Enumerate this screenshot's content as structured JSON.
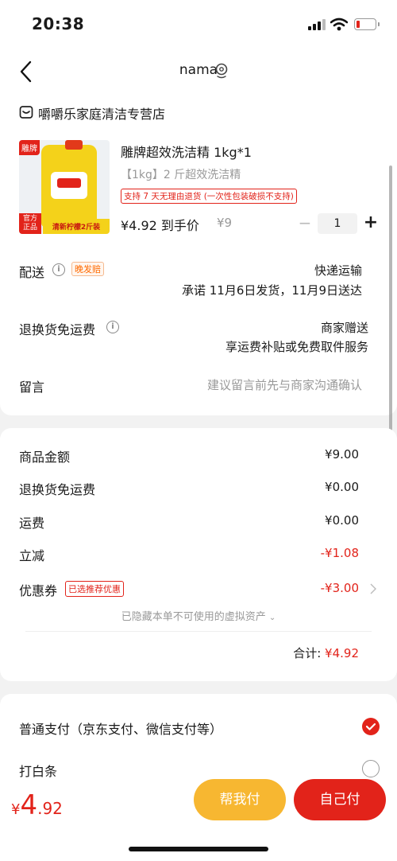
{
  "status_bar": {
    "time": "20:38"
  },
  "header": {
    "title": "nama"
  },
  "store": {
    "name": "嚼嚼乐家庭清洁专营店"
  },
  "product": {
    "title": "雕牌超效洗洁精 1kg*1",
    "spec": "【1kg】2 斤超效洗洁精",
    "return_tag": "支持 7 天无理由退货 (一次性包装破损不支持)",
    "price": "¥4.92 到手价",
    "original_price": "¥9",
    "quantity": "1",
    "image_badges": {
      "brand": "雕牌",
      "official": "官方\n正品",
      "promo": "清新柠檬2斤装"
    }
  },
  "delivery": {
    "label": "配送",
    "tag": "晚发赔",
    "method": "快递运输",
    "promise": "承诺 11月6日发货，11月9日送达"
  },
  "return_shipping": {
    "label": "退换货免运费",
    "value1": "商家赠送",
    "value2": "享运费补贴或免费取件服务"
  },
  "message": {
    "label": "留言",
    "placeholder": "建议留言前先与商家沟通确认"
  },
  "price_detail": {
    "goods_label": "商品金额",
    "goods_value": "¥9.00",
    "return_label": "退换货免运费",
    "return_value": "¥0.00",
    "freight_label": "运费",
    "freight_value": "¥0.00",
    "discount_label": "立减",
    "discount_value": "-¥1.08",
    "coupon_label": "优惠券",
    "coupon_tag": "已选推荐优惠",
    "coupon_value": "-¥3.00",
    "hidden_assets": "已隐藏本单不可使用的虚拟资产",
    "total_label": "合计:",
    "total_value": "¥4.92"
  },
  "payment": {
    "option1": "普通支付（京东支付、微信支付等）",
    "option2": "打白条"
  },
  "bottom_bar": {
    "currency": "¥",
    "amount_int": "4",
    "amount_dec": ".92",
    "help_pay": "帮我付",
    "self_pay": "自己付"
  },
  "colors": {
    "accent_red": "#e2231a",
    "help_pay_yellow": "#f7b731",
    "orange_tag": "#ff6a00"
  }
}
